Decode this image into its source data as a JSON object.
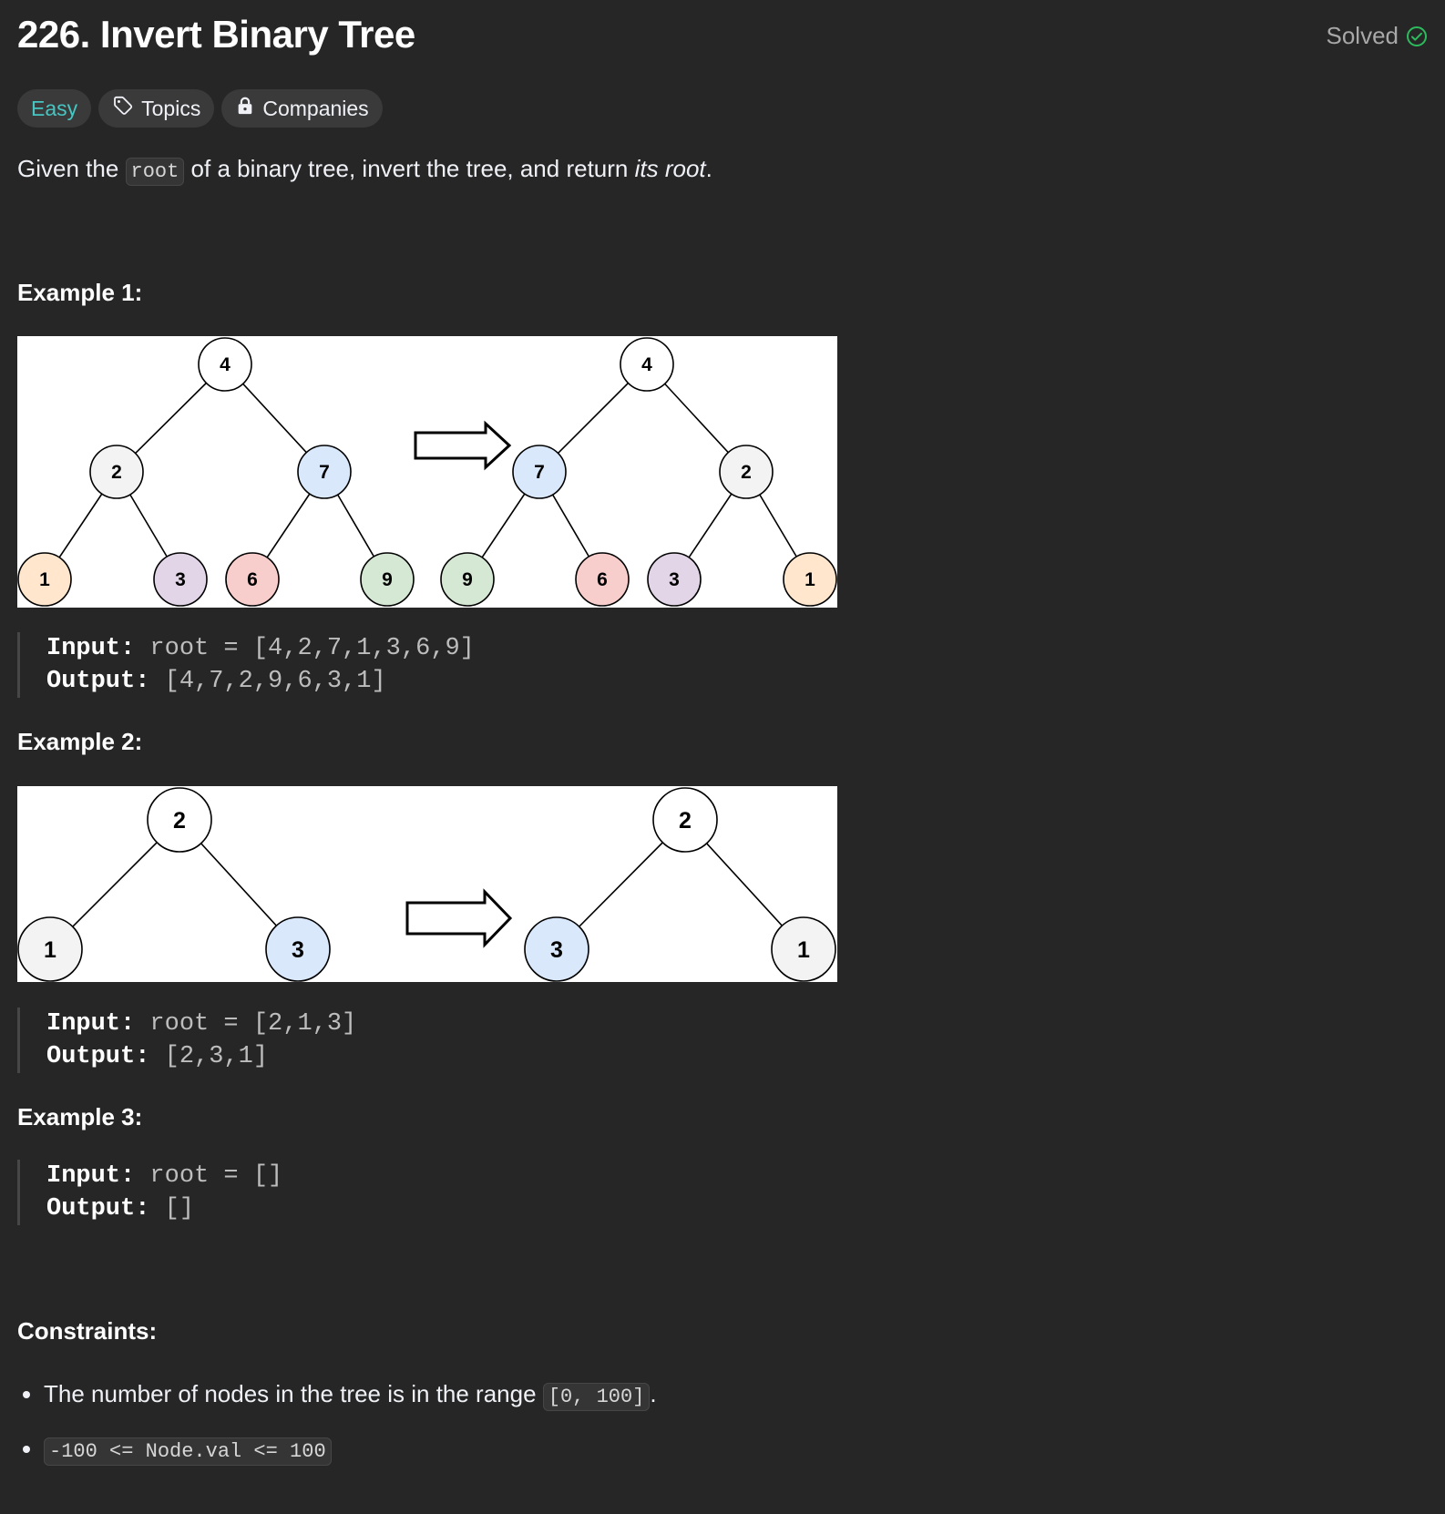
{
  "problem": {
    "title": "226. Invert Binary Tree",
    "solved_label": "Solved",
    "difficulty": "Easy",
    "topics_label": "Topics",
    "companies_label": "Companies",
    "description": {
      "prefix": "Given the ",
      "code": "root",
      "middle": " of a binary tree, invert the tree, and return ",
      "emphasis": "its root",
      "suffix": "."
    }
  },
  "examples": [
    {
      "heading": "Example 1:",
      "input_label": "Input:",
      "input_value": "root = [4,2,7,1,3,6,9]",
      "output_label": "Output:",
      "output_value": "[4,7,2,9,6,3,1]",
      "figure": {
        "before": {
          "root": "4",
          "left": "2",
          "right": "7",
          "ll": "1",
          "lr": "3",
          "rl": "6",
          "rr": "9"
        },
        "after": {
          "root": "4",
          "left": "7",
          "right": "2",
          "ll": "9",
          "lr": "6",
          "rl": "3",
          "rr": "1"
        }
      }
    },
    {
      "heading": "Example 2:",
      "input_label": "Input:",
      "input_value": "root = [2,1,3]",
      "output_label": "Output:",
      "output_value": "[2,3,1]",
      "figure": {
        "before": {
          "root": "2",
          "left": "1",
          "right": "3"
        },
        "after": {
          "root": "2",
          "left": "3",
          "right": "1"
        }
      }
    },
    {
      "heading": "Example 3:",
      "input_label": "Input:",
      "input_value": "root = []",
      "output_label": "Output:",
      "output_value": "[]"
    }
  ],
  "constraints": {
    "heading": "Constraints:",
    "items": [
      {
        "text": "The number of nodes in the tree is in the range ",
        "code": "[0, 100]",
        "suffix": "."
      },
      {
        "text": "",
        "code": "-100 <= Node.val <= 100",
        "suffix": ""
      }
    ]
  },
  "colors": {
    "background": "#262626",
    "easy": "#46c6c2",
    "solved_check": "#2cbb5d",
    "node_white": "#ffffff",
    "node_gray": "#f3f3f3",
    "node_blue": "#dae8fc",
    "node_orange": "#ffe6cc",
    "node_purple": "#e1d5e7",
    "node_red": "#f8cecc",
    "node_green": "#d5e8d4"
  }
}
